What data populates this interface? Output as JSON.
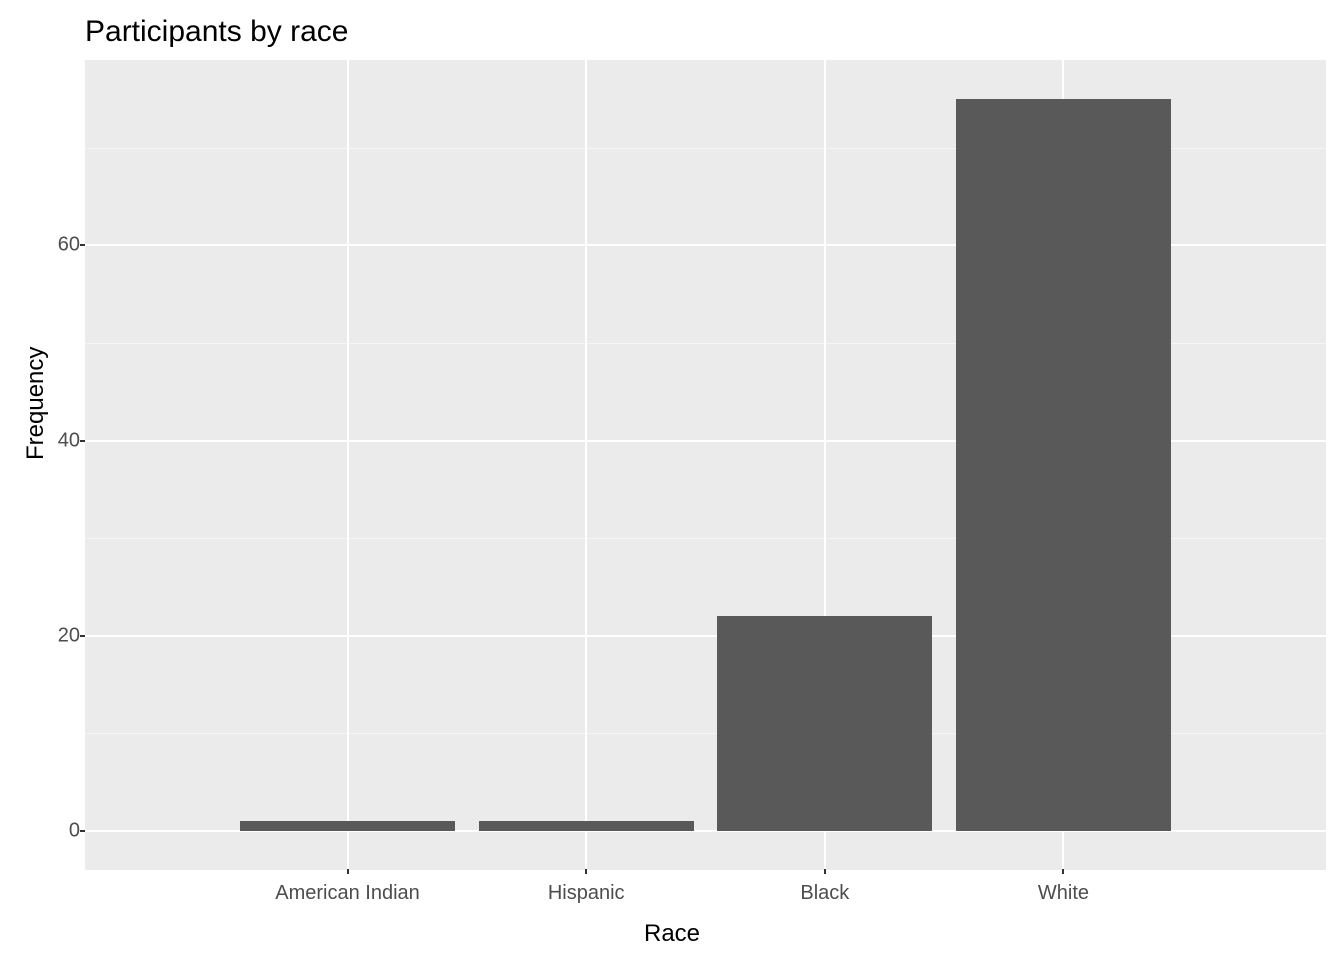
{
  "chart_data": {
    "type": "bar",
    "title": "Participants by race",
    "xlabel": "Race",
    "ylabel": "Frequency",
    "categories": [
      "American Indian",
      "Hispanic",
      "Black",
      "White"
    ],
    "values": [
      1,
      1,
      22,
      75
    ],
    "y_ticks": [
      0,
      20,
      40,
      60
    ],
    "y_minor_ticks": [
      10,
      30,
      50,
      70
    ],
    "ylim": [
      -4,
      79
    ]
  }
}
